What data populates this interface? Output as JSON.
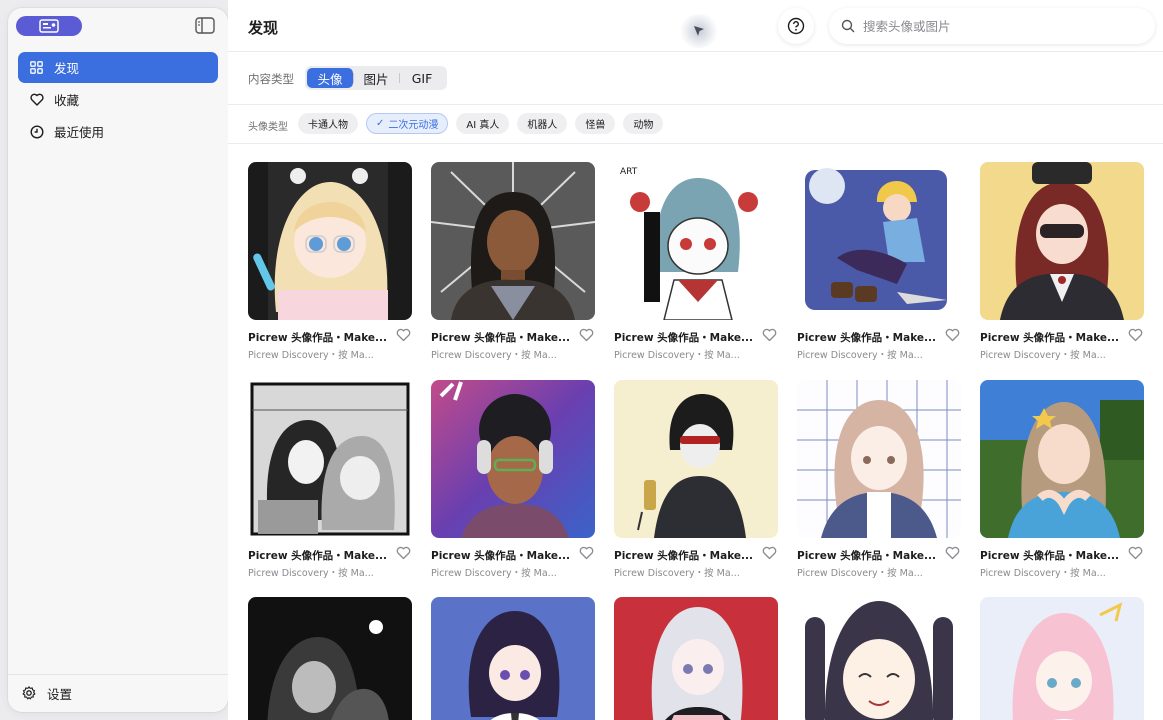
{
  "sidebar": {
    "items": [
      {
        "label": "发现",
        "icon": "grid-icon",
        "active": true
      },
      {
        "label": "收藏",
        "icon": "heart-icon",
        "active": false
      },
      {
        "label": "最近使用",
        "icon": "clock-icon",
        "active": false
      }
    ],
    "settings_label": "设置"
  },
  "header": {
    "title": "发现",
    "search_placeholder": "搜索头像或图片"
  },
  "content_type": {
    "label": "内容类型",
    "options": [
      "头像",
      "图片",
      "GIF"
    ],
    "selected": "头像"
  },
  "avatar_type": {
    "label": "头像类型",
    "chips": [
      "卡通人物",
      "二次元动漫",
      "AI 真人",
      "机器人",
      "怪兽",
      "动物"
    ],
    "selected": "二次元动漫"
  },
  "colors": {
    "accent": "#3b6fe0",
    "app_badge": "#5b5bd6"
  },
  "cards": [
    {
      "title": "Picrew 头像作品・Make...",
      "subtitle": "Picrew Discovery・按 Ma..."
    },
    {
      "title": "Picrew 头像作品・Make...",
      "subtitle": "Picrew Discovery・按 Ma..."
    },
    {
      "title": "Picrew 头像作品・Make...",
      "subtitle": "Picrew Discovery・按 Ma..."
    },
    {
      "title": "Picrew 头像作品・Make...",
      "subtitle": "Picrew Discovery・按 Ma..."
    },
    {
      "title": "Picrew 头像作品・Make...",
      "subtitle": "Picrew Discovery・按 Ma..."
    },
    {
      "title": "Picrew 头像作品・Make...",
      "subtitle": "Picrew Discovery・按 Ma..."
    },
    {
      "title": "Picrew 头像作品・Make...",
      "subtitle": "Picrew Discovery・按 Ma..."
    },
    {
      "title": "Picrew 头像作品・Make...",
      "subtitle": "Picrew Discovery・按 Ma..."
    },
    {
      "title": "Picrew 头像作品・Make...",
      "subtitle": "Picrew Discovery・按 Ma..."
    },
    {
      "title": "Picrew 头像作品・Make...",
      "subtitle": "Picrew Discovery・按 Ma..."
    },
    {
      "title": "",
      "subtitle": ""
    },
    {
      "title": "",
      "subtitle": ""
    },
    {
      "title": "",
      "subtitle": ""
    },
    {
      "title": "",
      "subtitle": ""
    },
    {
      "title": "",
      "subtitle": ""
    }
  ]
}
